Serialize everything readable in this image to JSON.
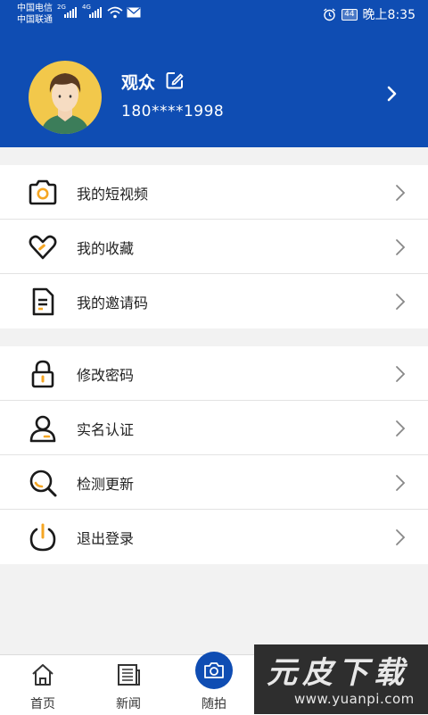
{
  "status_bar": {
    "carrier_1": "中国电信",
    "carrier_2": "中国联通",
    "net_1": "2G",
    "net_2": "4G",
    "battery": "44",
    "time": "晚上8:35"
  },
  "profile": {
    "name": "观众",
    "phone": "180****1998"
  },
  "menu_group_1": [
    {
      "label": "我的短视频",
      "icon": "camera-icon"
    },
    {
      "label": "我的收藏",
      "icon": "heart-icon"
    },
    {
      "label": "我的邀请码",
      "icon": "document-icon"
    }
  ],
  "menu_group_2": [
    {
      "label": "修改密码",
      "icon": "lock-icon"
    },
    {
      "label": "实名认证",
      "icon": "person-icon"
    },
    {
      "label": "检测更新",
      "icon": "search-icon"
    },
    {
      "label": "退出登录",
      "icon": "power-icon"
    }
  ],
  "tabbar": [
    {
      "label": "首页",
      "icon": "home-icon"
    },
    {
      "label": "新闻",
      "icon": "news-icon"
    },
    {
      "label": "随拍",
      "icon": "camera-icon"
    }
  ],
  "watermark": {
    "brand": "元皮下载",
    "url": "www.yuanpi.com"
  },
  "colors": {
    "primary": "#0f4db3",
    "accent": "#f5a623"
  }
}
